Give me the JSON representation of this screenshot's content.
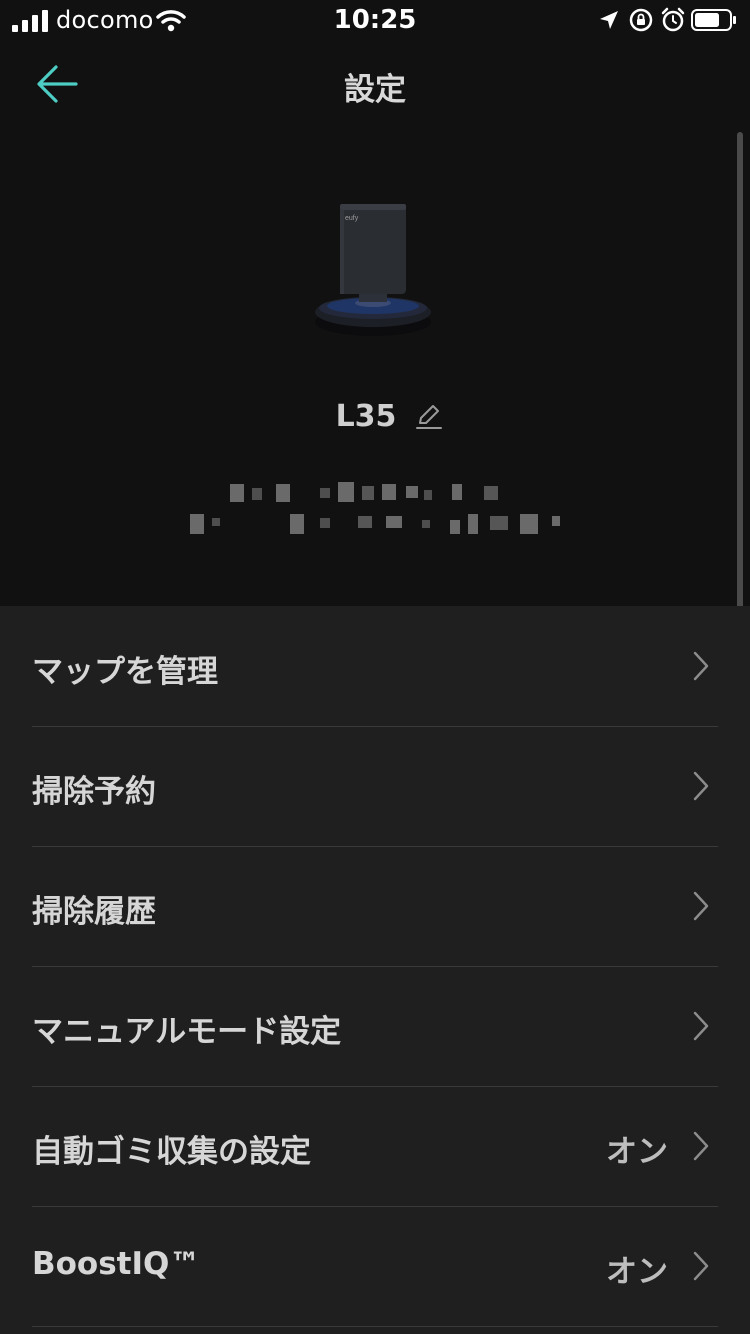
{
  "status_bar": {
    "carrier": "docomo",
    "time": "10:25",
    "icons": [
      "signal-icon",
      "wifi-icon",
      "location-arrow-icon",
      "rotation-lock-icon",
      "alarm-icon",
      "battery-icon"
    ]
  },
  "nav": {
    "title": "設定",
    "back_icon": "back-arrow-icon"
  },
  "device": {
    "name": "L35",
    "edit_icon": "pencil-edit-icon",
    "image_icon": "robot-vacuum-with-dock",
    "brand_mark": "eufy"
  },
  "settings": {
    "items": [
      {
        "label": "マップを管理",
        "value": ""
      },
      {
        "label": "掃除予約",
        "value": ""
      },
      {
        "label": "掃除履歴",
        "value": ""
      },
      {
        "label": "マニュアルモード設定",
        "value": ""
      },
      {
        "label": "自動ゴミ収集の設定",
        "value": "オン"
      },
      {
        "label": "BoostIQ™",
        "value": "オン"
      }
    ]
  },
  "colors": {
    "background": "#111111",
    "panel": "#1f1f1f",
    "accent": "#4ecdc4",
    "divider": "#3a3a3a",
    "text": "#d6d6d6"
  }
}
